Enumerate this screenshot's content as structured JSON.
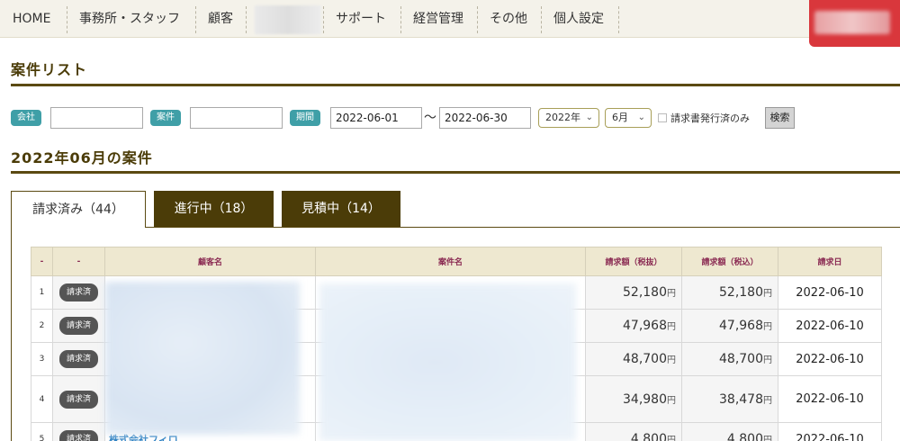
{
  "nav": {
    "home": "HOME",
    "office_staff": "事務所・スタッフ",
    "customers": "顧客",
    "support": "サポート",
    "management": "経営管理",
    "other": "その他",
    "personal": "個人設定"
  },
  "page_title": "案件リスト",
  "filters": {
    "company_tag": "会社",
    "company_value": "",
    "case_tag": "案件",
    "case_value": "",
    "period_tag": "期間",
    "date_from": "2022-06-01",
    "date_separator": "〜",
    "date_to": "2022-06-30",
    "year_select": "2022年",
    "month_select": "6月",
    "invoice_only_label": "請求書発行済のみ",
    "invoice_only_checked": false,
    "search_label": "検索"
  },
  "section_title": "2022年06月の案件",
  "tabs": [
    {
      "label": "請求済み（44）",
      "active": true
    },
    {
      "label": "進行中（18）",
      "active": false
    },
    {
      "label": "見積中（14）",
      "active": false
    }
  ],
  "table": {
    "headers": [
      "-",
      "-",
      "顧客名",
      "案件名",
      "請求額（税抜）",
      "請求額（税込）",
      "請求日"
    ],
    "yen": "円",
    "rows": [
      {
        "no": "1",
        "status": "請求済",
        "customer": "",
        "case": "",
        "amount_ex": "52,180",
        "amount_in": "52,180",
        "date": "2022-06-10"
      },
      {
        "no": "2",
        "status": "請求済",
        "customer": "",
        "case": "",
        "amount_ex": "47,968",
        "amount_in": "47,968",
        "date": "2022-06-10"
      },
      {
        "no": "3",
        "status": "請求済",
        "customer": "",
        "case": "",
        "amount_ex": "48,700",
        "amount_in": "48,700",
        "date": "2022-06-10"
      },
      {
        "no": "4",
        "status": "請求済",
        "customer": "",
        "case": "",
        "amount_ex": "34,980",
        "amount_in": "38,478",
        "date": "2022-06-10"
      },
      {
        "no": "5",
        "status": "請求済",
        "customer": "株式会社フィロ",
        "case": "",
        "amount_ex": "4,800",
        "amount_in": "4,800",
        "date": "2022-06-10"
      }
    ]
  },
  "colors": {
    "brand_dark": "#4b3c08",
    "tag_teal": "#3f9fa7",
    "header_text": "#8a2a52",
    "account_red": "#d9373c"
  }
}
